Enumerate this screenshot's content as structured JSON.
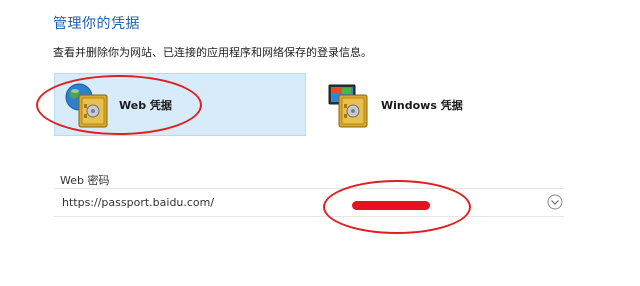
{
  "page": {
    "title": "管理你的凭据",
    "description": "查看并删除你为网站、已连接的应用程序和网络保存的登录信息。"
  },
  "credential_types": [
    {
      "label": "Web 凭据",
      "icon": "web-credential-vault-icon",
      "selected": true
    },
    {
      "label": "Windows 凭据",
      "icon": "windows-credential-vault-icon",
      "selected": false
    }
  ],
  "web_passwords": {
    "section_label": "Web 密码",
    "entries": [
      {
        "url": "https://passport.baidu.com/",
        "expand_icon": "chevron-down-icon"
      }
    ]
  },
  "colors": {
    "title": "#1f5fa8",
    "selected_tile": "#d7ebfa",
    "annotation": "#e02020",
    "redaction": "#e8101f"
  }
}
